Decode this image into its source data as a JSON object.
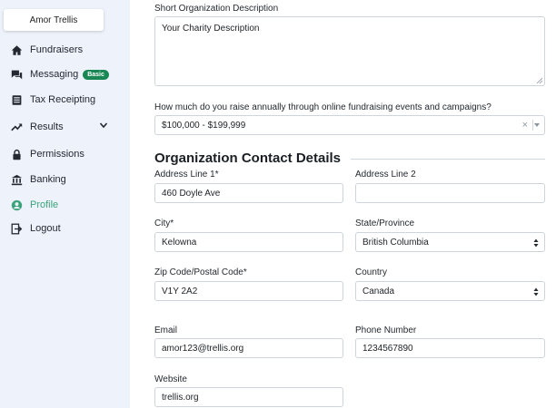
{
  "sidebar": {
    "org_name": "Amor Trellis",
    "items": [
      {
        "label": "Fundraisers",
        "icon": "home-icon"
      },
      {
        "label": "Messaging",
        "icon": "chat-icon",
        "badge": "Basic"
      },
      {
        "label": "Tax Receipting",
        "icon": "receipt-icon"
      },
      {
        "label": "Results",
        "icon": "trending-up-icon"
      },
      {
        "label": "Permissions",
        "icon": "lock-icon"
      },
      {
        "label": "Banking",
        "icon": "bank-icon"
      },
      {
        "label": "Profile",
        "icon": "user-circle-icon",
        "active": true
      },
      {
        "label": "Logout",
        "icon": "logout-icon"
      }
    ]
  },
  "form": {
    "short_description": {
      "label": "Short Organization Description",
      "value": "Your Charity Description"
    },
    "annual_raise": {
      "label": "How much do you raise annually through online fundraising events and campaigns?",
      "value": "$100,000 - $199,999",
      "clear": "×"
    },
    "section_title": "Organization Contact Details",
    "address1": {
      "label": "Address Line 1*",
      "value": "460 Doyle Ave"
    },
    "address2": {
      "label": "Address Line 2",
      "value": ""
    },
    "city": {
      "label": "City*",
      "value": "Kelowna"
    },
    "state": {
      "label": "State/Province",
      "value": "British Columbia"
    },
    "zip": {
      "label": "Zip Code/Postal Code*",
      "value": "V1Y 2A2"
    },
    "country": {
      "label": "Country",
      "value": "Canada"
    },
    "email": {
      "label": "Email",
      "value": "amor123@trellis.org"
    },
    "phone": {
      "label": "Phone Number",
      "value": "1234567890"
    },
    "website": {
      "label": "Website",
      "value": "trellis.org"
    }
  },
  "colors": {
    "sidebar_bg": "#eef2fb",
    "active": "#3aa37a",
    "badge": "#198754"
  }
}
